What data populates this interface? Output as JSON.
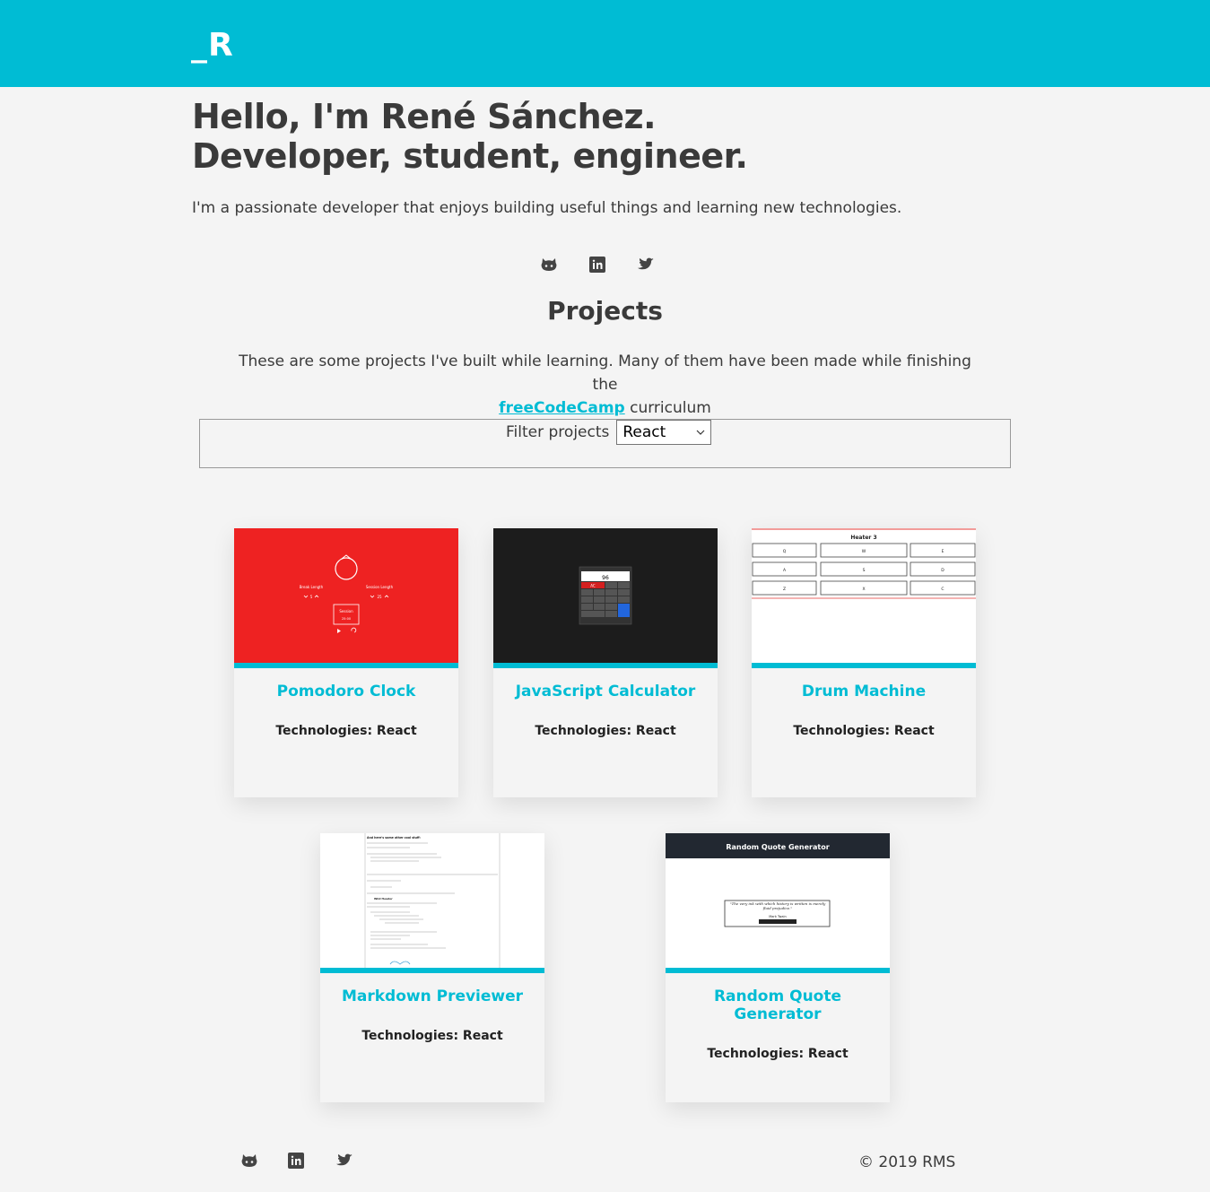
{
  "header": {
    "logo": "_R"
  },
  "hero": {
    "title_line1": "Hello, I'm René Sánchez.",
    "title_line2": "Developer, student, engineer.",
    "subtitle": "I'm a passionate developer that enjoys building useful things and learning new technologies."
  },
  "social": [
    {
      "icon": "github-icon"
    },
    {
      "icon": "linkedin-icon"
    },
    {
      "icon": "twitter-icon"
    }
  ],
  "projects": {
    "title": "Projects",
    "desc_before": "These are some projects I've built while learning. Many of them have been made while finishing the",
    "desc_link": "freeCodeCamp",
    "desc_after": "curriculum",
    "filter_label": "Filter projects",
    "filter_value": "React",
    "cards": [
      {
        "name": "Pomodoro Clock",
        "tech": "Technologies: React"
      },
      {
        "name": "JavaScript Calculator",
        "tech": "Technologies: React"
      },
      {
        "name": "Drum Machine",
        "tech": "Technologies: React"
      },
      {
        "name": "Markdown Previewer",
        "tech": "Technologies: React"
      },
      {
        "name": "Random Quote Generator",
        "tech": "Technologies: React"
      }
    ]
  },
  "thumbs": {
    "pomodoro": {
      "break_label": "Break Length",
      "session_label": "Session Length",
      "break_value": "5",
      "session_value": "25",
      "timer_label": "Session",
      "timer_value": "25:00"
    },
    "calculator": {
      "display": "96",
      "clear": "AC"
    },
    "drum": {
      "title": "Heater 3",
      "keys": [
        "Q",
        "W",
        "E",
        "A",
        "S",
        "D",
        "Z",
        "X",
        "C"
      ]
    },
    "markdown": {
      "heading": "And here's some other cool stuff:",
      "subheading": "Wild Header"
    },
    "quote": {
      "title": "Random Quote Generator",
      "quote": "\"The very ink with which history is written is merely fluid prejudice.\"",
      "author": "Mark Twain"
    }
  },
  "footer": {
    "copyright": "© 2019 RMS"
  },
  "colors": {
    "accent": "#00bcd4",
    "text": "#3a3a3a",
    "background": "#f4f4f4"
  }
}
